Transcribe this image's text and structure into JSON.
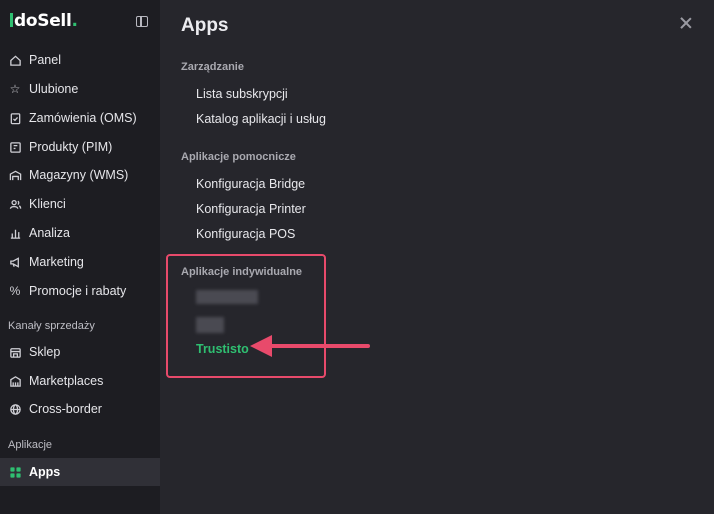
{
  "sidebar": {
    "logo": {
      "text": "IdoSell",
      "accent": "#2fbf71"
    },
    "items": [
      {
        "label": "Panel",
        "icon": "home-icon"
      },
      {
        "label": "Ulubione",
        "icon": "star-icon"
      },
      {
        "label": "Zamówienia (OMS)",
        "icon": "clipboard-check-icon"
      },
      {
        "label": "Produkty (PIM)",
        "icon": "product-box-icon"
      },
      {
        "label": "Magazyny (WMS)",
        "icon": "warehouse-icon"
      },
      {
        "label": "Klienci",
        "icon": "users-icon"
      },
      {
        "label": "Analiza",
        "icon": "bar-chart-icon"
      },
      {
        "label": "Marketing",
        "icon": "megaphone-icon"
      },
      {
        "label": "Promocje i rabaty",
        "icon": "percent-icon"
      }
    ],
    "sales_channels_title": "Kanały sprzedaży",
    "sales_channels": [
      {
        "label": "Sklep",
        "icon": "shop-icon"
      },
      {
        "label": "Marketplaces",
        "icon": "marketplace-icon"
      },
      {
        "label": "Cross-border",
        "icon": "globe-icon"
      }
    ],
    "applications_title": "Aplikacje",
    "applications": [
      {
        "label": "Apps",
        "icon": "apps-grid-icon",
        "active": true
      }
    ]
  },
  "main": {
    "title": "Apps",
    "groups": [
      {
        "title": "Zarządzanie",
        "links": [
          "Lista subskrypcji",
          "Katalog aplikacji i usług"
        ]
      },
      {
        "title": "Aplikacje pomocnicze",
        "links": [
          "Konfiguracja Bridge",
          "Konfiguracja Printer",
          "Konfiguracja POS"
        ]
      },
      {
        "title": "Aplikacje indywidualne",
        "links": [
          "Trustisto"
        ]
      }
    ]
  },
  "colors": {
    "highlight": "#e84a6b",
    "green": "#2fbf71"
  }
}
